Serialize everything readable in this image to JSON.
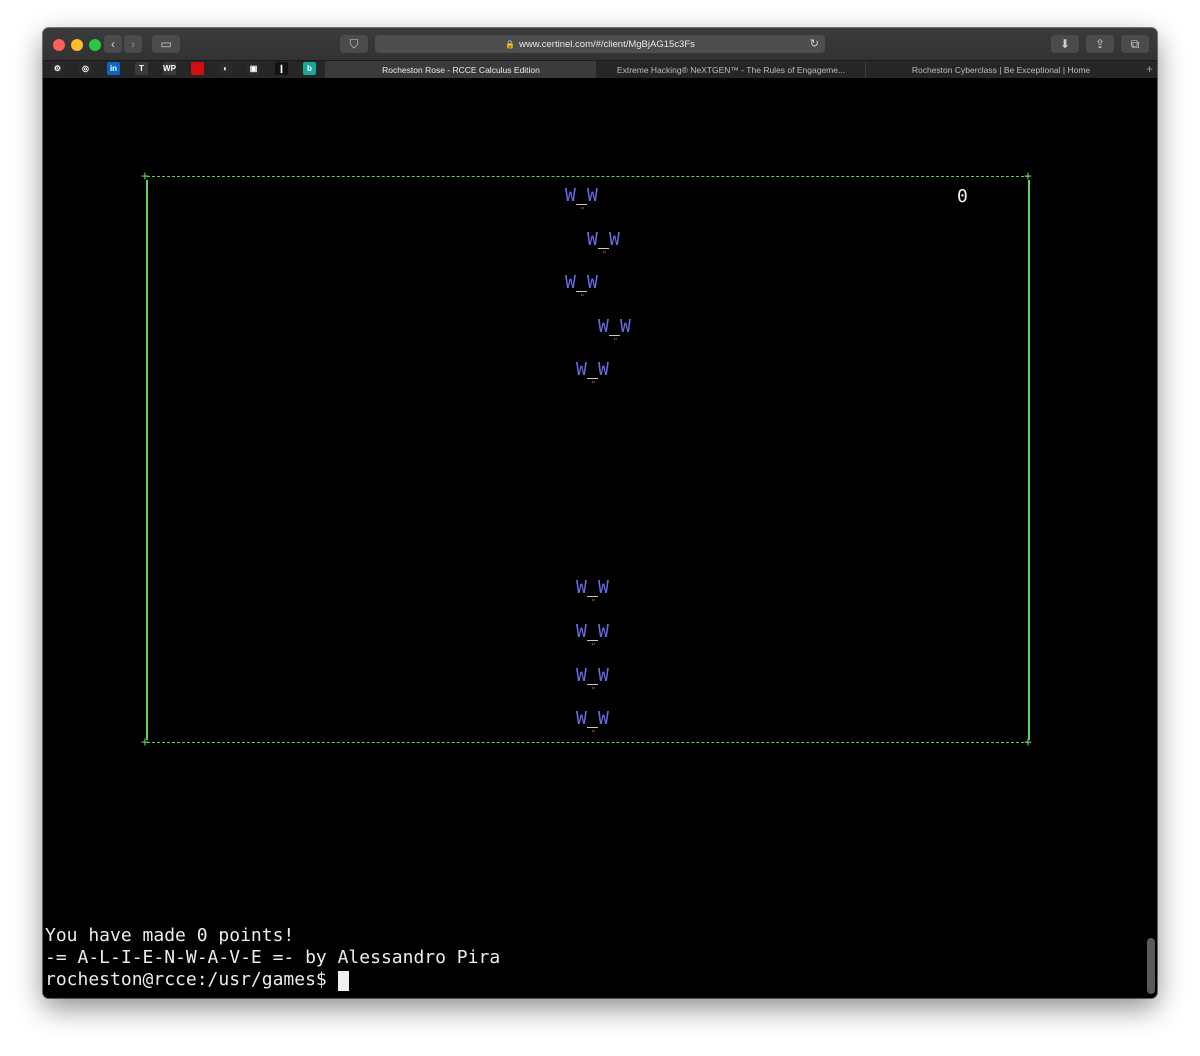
{
  "browser": {
    "url": "www.certinel.com/#/client/MgBjAG15c3Fs",
    "favicons": [
      {
        "name": "settings",
        "glyph": "⚙",
        "color": "#2a2a2a"
      },
      {
        "name": "camera-circle",
        "glyph": "◎",
        "color": "#2a2a2a"
      },
      {
        "name": "linkedin",
        "glyph": "in",
        "color": "#0a66c2"
      },
      {
        "name": "t-logo",
        "glyph": "T",
        "color": "#3a3a3a"
      },
      {
        "name": "wp-logo",
        "glyph": "WP",
        "color": "#3a3a3a"
      },
      {
        "name": "red-square",
        "glyph": "",
        "color": "#d01010"
      },
      {
        "name": "orange-circle",
        "glyph": "◐",
        "color": "#2a2a2a"
      },
      {
        "name": "camera",
        "glyph": "▣",
        "color": "#2a2a2a"
      },
      {
        "name": "dark-app",
        "glyph": "❙",
        "color": "#111111"
      },
      {
        "name": "teal-app",
        "glyph": "b",
        "color": "#18a89a"
      }
    ],
    "tabs": [
      {
        "label": "Rocheston Rose - RCCE Calculus Edition",
        "active": true
      },
      {
        "label": "Extreme Hacking® NeXTGEN™ - The Rules of Engageme...",
        "active": false
      },
      {
        "label": "Rocheston Cyberclass | Be Exceptional | Home",
        "active": false
      }
    ]
  },
  "game": {
    "score": "0",
    "colors": {
      "border": "#5fd35f",
      "alien": "#6a6ae6",
      "leg": "#e05050"
    },
    "alien_glyph": "W",
    "leg_glyph": "\"",
    "aliens": [
      {
        "col": 0,
        "row": 0
      },
      {
        "col": 2,
        "row": 1
      },
      {
        "col": 0,
        "row": 2
      },
      {
        "col": 3,
        "row": 3
      },
      {
        "col": 1,
        "row": 4
      },
      {
        "col": 1,
        "row": 9
      },
      {
        "col": 1,
        "row": 10
      },
      {
        "col": 1,
        "row": 11
      },
      {
        "col": 1,
        "row": 12
      }
    ]
  },
  "terminal": {
    "line1": "You have made 0 points!",
    "line2": "-= A-L-I-E-N-W-A-V-E =- by Alessandro Pira",
    "prompt": "rocheston@rcce:/usr/games$ "
  }
}
